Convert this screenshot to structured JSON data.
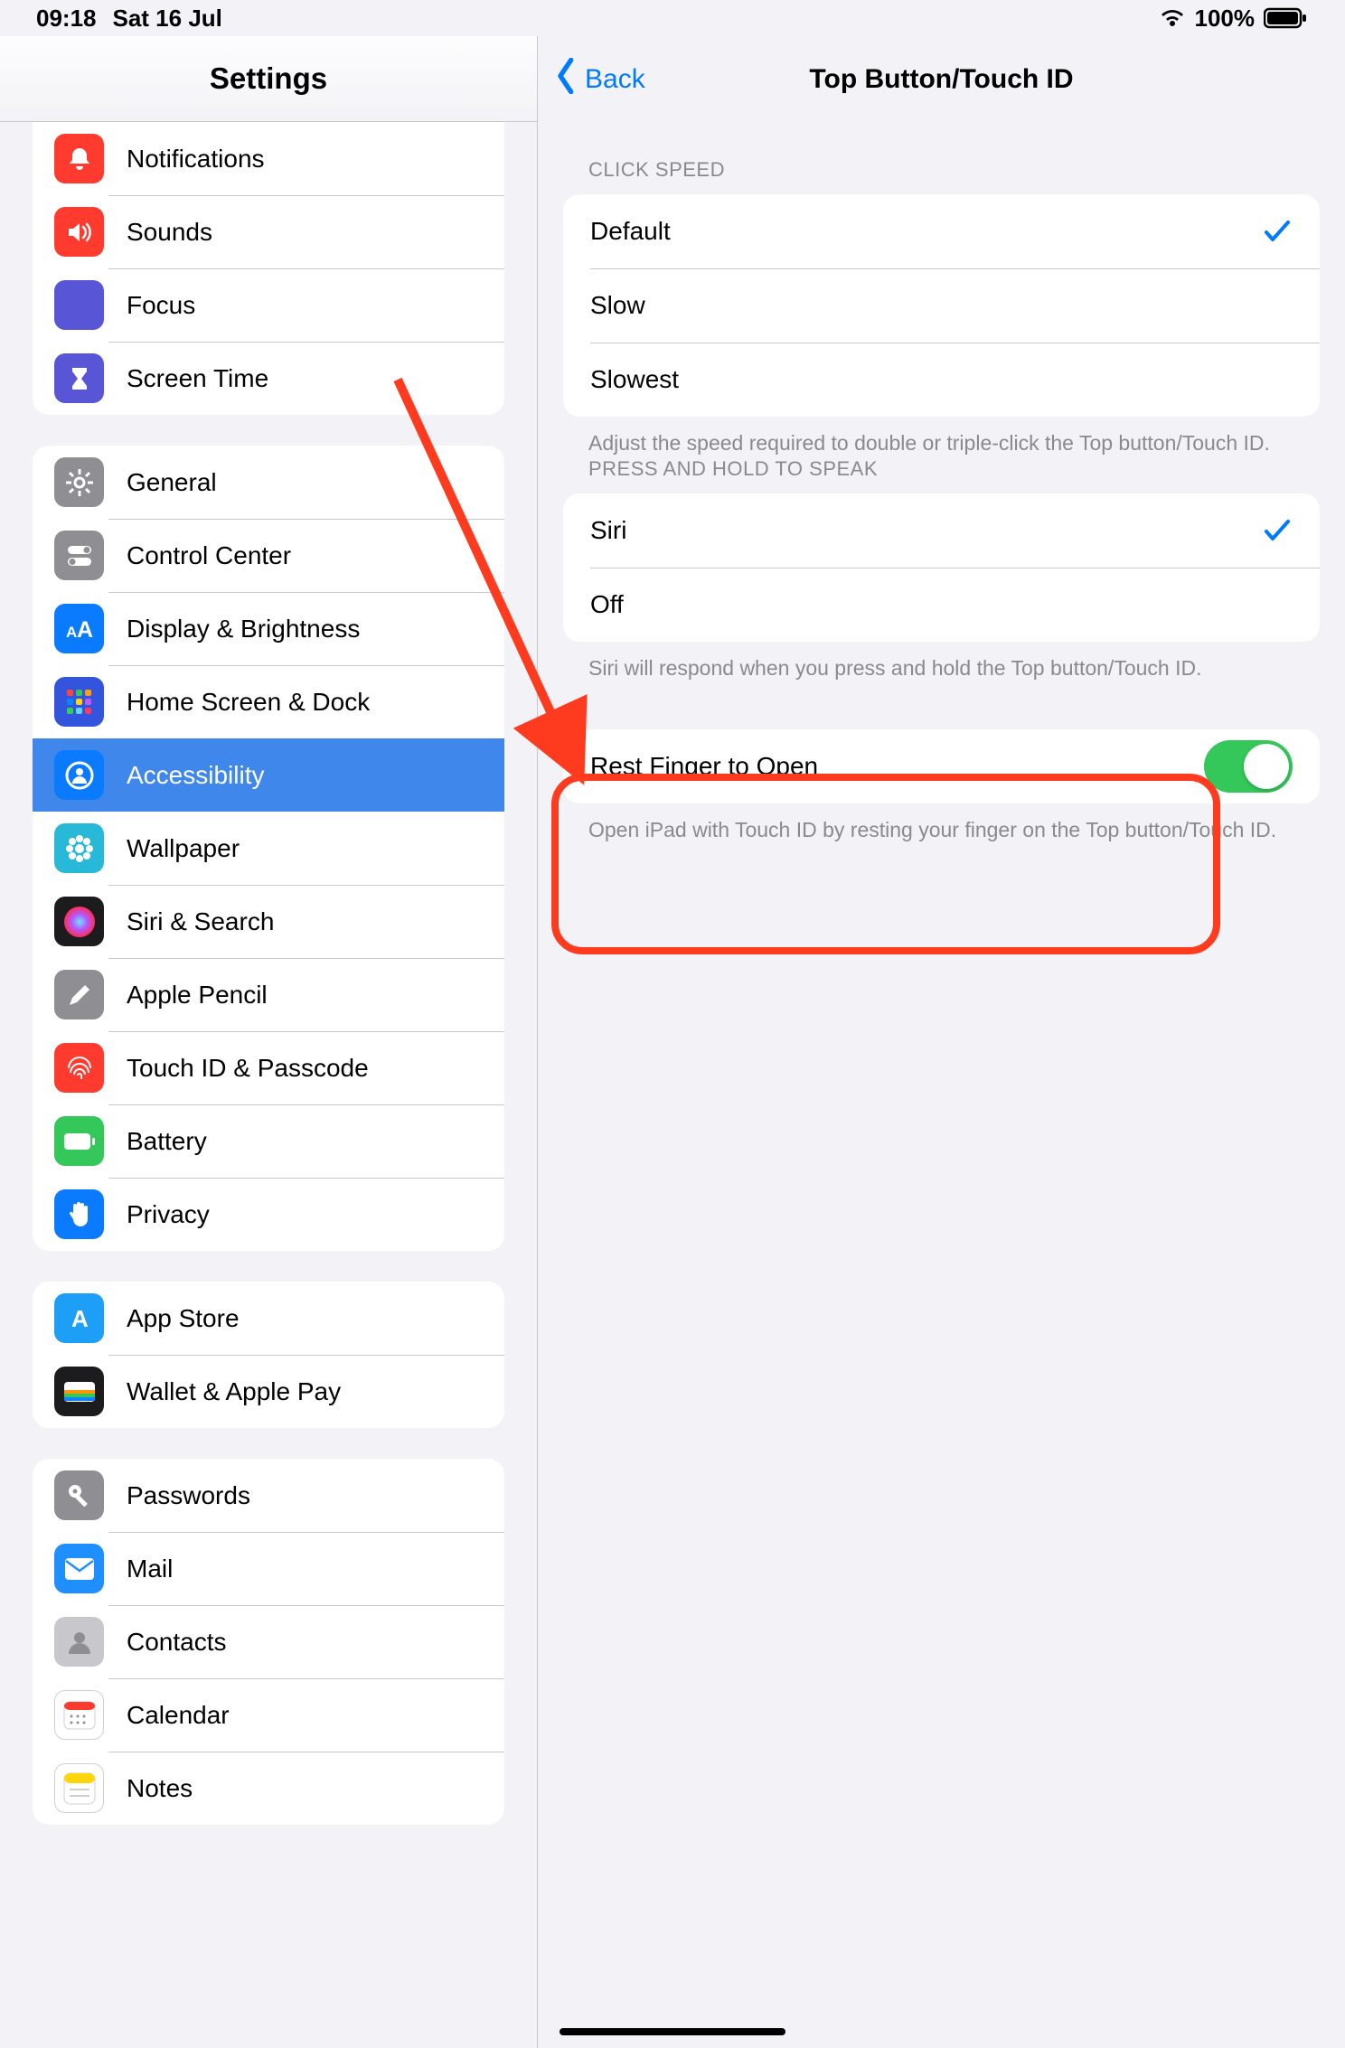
{
  "status": {
    "time": "09:18",
    "date": "Sat 16 Jul",
    "battery_pct": "100%"
  },
  "left": {
    "title": "Settings",
    "groups": [
      {
        "first_visible": true,
        "items": [
          {
            "key": "notifications",
            "label": "Notifications",
            "bg": "#ff3b30",
            "icon": "bell"
          },
          {
            "key": "sounds",
            "label": "Sounds",
            "bg": "#ff3b30",
            "icon": "speaker"
          },
          {
            "key": "focus",
            "label": "Focus",
            "bg": "#5856d6",
            "icon": "moon"
          },
          {
            "key": "screentime",
            "label": "Screen Time",
            "bg": "#5856d6",
            "icon": "hourglass"
          }
        ]
      },
      {
        "items": [
          {
            "key": "general",
            "label": "General",
            "bg": "#8e8e93",
            "icon": "gear"
          },
          {
            "key": "controlcenter",
            "label": "Control Center",
            "bg": "#8e8e93",
            "icon": "toggles"
          },
          {
            "key": "display",
            "label": "Display & Brightness",
            "bg": "#0a7aff",
            "icon": "aa"
          },
          {
            "key": "homescreen",
            "label": "Home Screen & Dock",
            "bg": "#3355dd",
            "icon": "grid"
          },
          {
            "key": "accessibility",
            "label": "Accessibility",
            "bg": "#0a7aff",
            "icon": "person",
            "selected": true
          },
          {
            "key": "wallpaper",
            "label": "Wallpaper",
            "bg": "#28b8d8",
            "icon": "flower"
          },
          {
            "key": "siri",
            "label": "Siri & Search",
            "bg": "#1c1c1e",
            "icon": "siri"
          },
          {
            "key": "pencil",
            "label": "Apple Pencil",
            "bg": "#8e8e93",
            "icon": "pencil"
          },
          {
            "key": "touchid",
            "label": "Touch ID & Passcode",
            "bg": "#ff3b30",
            "icon": "finger"
          },
          {
            "key": "battery",
            "label": "Battery",
            "bg": "#34c759",
            "icon": "battery"
          },
          {
            "key": "privacy",
            "label": "Privacy",
            "bg": "#0a7aff",
            "icon": "hand"
          }
        ]
      },
      {
        "items": [
          {
            "key": "appstore",
            "label": "App Store",
            "bg": "#1e9ff7",
            "icon": "appstore"
          },
          {
            "key": "wallet",
            "label": "Wallet & Apple Pay",
            "bg": "#1c1c1e",
            "icon": "wallet"
          }
        ]
      },
      {
        "items": [
          {
            "key": "passwords",
            "label": "Passwords",
            "bg": "#8e8e93",
            "icon": "key"
          },
          {
            "key": "mail",
            "label": "Mail",
            "bg": "#1f8fff",
            "icon": "mail"
          },
          {
            "key": "contacts",
            "label": "Contacts",
            "bg": "#c8c8cc",
            "icon": "contact"
          },
          {
            "key": "calendar",
            "label": "Calendar",
            "bg": "#ffffff",
            "icon": "calendar"
          },
          {
            "key": "notes",
            "label": "Notes",
            "bg": "#ffffff",
            "icon": "notes"
          }
        ]
      }
    ]
  },
  "right": {
    "back": "Back",
    "title": "Top Button/Touch ID",
    "sections": [
      {
        "header": "CLICK SPEED",
        "rows": [
          {
            "label": "Default",
            "checked": true
          },
          {
            "label": "Slow"
          },
          {
            "label": "Slowest"
          }
        ],
        "footer": "Adjust the speed required to double or triple-click the Top button/Touch ID."
      },
      {
        "header": "PRESS AND HOLD TO SPEAK",
        "rows": [
          {
            "label": "Siri",
            "checked": true
          },
          {
            "label": "Off"
          }
        ],
        "footer": "Siri will respond when you press and hold the Top button/Touch ID."
      },
      {
        "rows": [
          {
            "label": "Rest Finger to Open",
            "switch": true,
            "on": true
          }
        ],
        "footer": "Open iPad with Touch ID by resting your finger on the Top button/Touch ID.",
        "highlighted": true
      }
    ]
  }
}
